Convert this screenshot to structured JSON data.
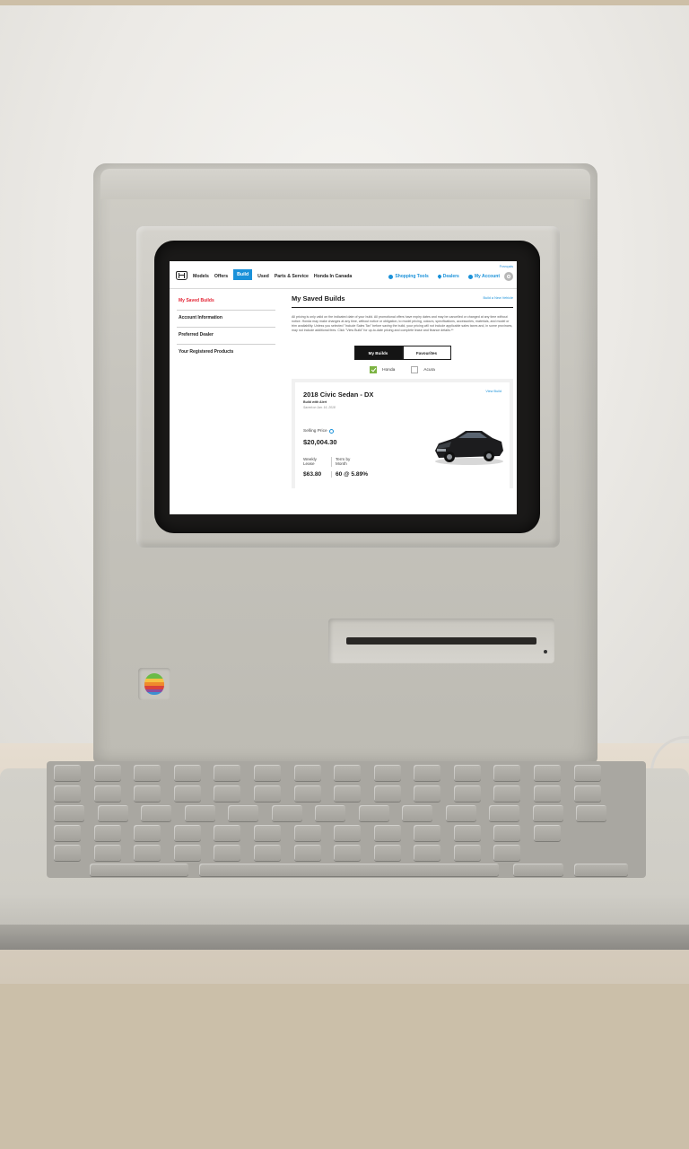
{
  "site": {
    "language_link": "Français",
    "nav": [
      "Models",
      "Offers",
      "Build",
      "Used",
      "Parts & Service",
      "Honda In Canada"
    ],
    "nav_active": "Build",
    "tools": {
      "shopping_tools": "Shopping Tools",
      "dealers": "Dealers",
      "account": "My Account"
    },
    "icons": {
      "logo": "honda-logo-icon",
      "tools": "gear-icon",
      "dealers": "map-pin-icon",
      "account": "user-icon",
      "search": "search-icon"
    },
    "accent_color": "#1a91d9",
    "active_color": "#e32636"
  },
  "sidebar": {
    "items": [
      "My Saved Builds",
      "Account Information",
      "Preferred Dealer",
      "Your Registered Products"
    ]
  },
  "main": {
    "title": "My Saved Builds",
    "build_new": "Build a New Vehicle",
    "disclaimer": "All pricing is only valid on the indicated date of your build. All promotional offers have expiry dates and may be cancelled or changed at any time without notice. Honda may make changes at any time, without notice or obligation, to model pricing, colours, specifications, accessories, materials, and model or trim availability. Unless you selected \"Include Sales Tax\" before saving the build, your pricing will not include applicable sales taxes and, in some provinces, may not include additional fees. Click \"View Build\" for up-to-date pricing and complete lease and finance details.**",
    "tabs": [
      "My Builds",
      "Favourites"
    ],
    "filters": [
      {
        "label": "Honda",
        "checked": true
      },
      {
        "label": "Acura",
        "checked": false
      }
    ]
  },
  "build_card": {
    "title": "2018 Civic Sedan - DX",
    "view_link": "View Build",
    "subtitle": "Build with Alert",
    "saved_on": "Saved on Jan. 16, 2018",
    "selling_price_label": "Selling Price",
    "selling_price": "$20,004.30",
    "weekly_lease_label": "Weekly Lease",
    "term_label": "Term by Month",
    "weekly_lease": "$63.80",
    "term": "60 @ 5.89%",
    "car_color": "#1c1c1e"
  }
}
